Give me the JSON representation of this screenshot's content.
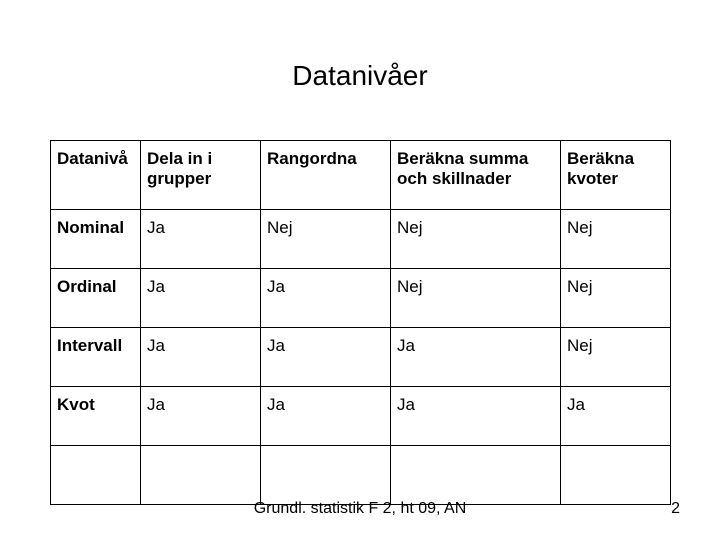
{
  "title": "Datanivåer",
  "headers": [
    "Datanivå",
    "Dela in i grupper",
    "Rangordna",
    "Beräkna summa och skillnader",
    "Beräkna kvoter"
  ],
  "rows": [
    {
      "level": "Nominal",
      "group": "Ja",
      "rank": "Nej",
      "sumdiff": "Nej",
      "quot": "Nej"
    },
    {
      "level": "Ordinal",
      "group": "Ja",
      "rank": "Ja",
      "sumdiff": "Nej",
      "quot": "Nej"
    },
    {
      "level": "Intervall",
      "group": "Ja",
      "rank": "Ja",
      "sumdiff": "Ja",
      "quot": "Nej"
    },
    {
      "level": "Kvot",
      "group": "Ja",
      "rank": "Ja",
      "sumdiff": "Ja",
      "quot": "Ja"
    },
    {
      "level": "",
      "group": "",
      "rank": "",
      "sumdiff": "",
      "quot": ""
    }
  ],
  "footer": {
    "credit": "Grundl. statistik F 2, ht 09, AN",
    "page": "2"
  }
}
